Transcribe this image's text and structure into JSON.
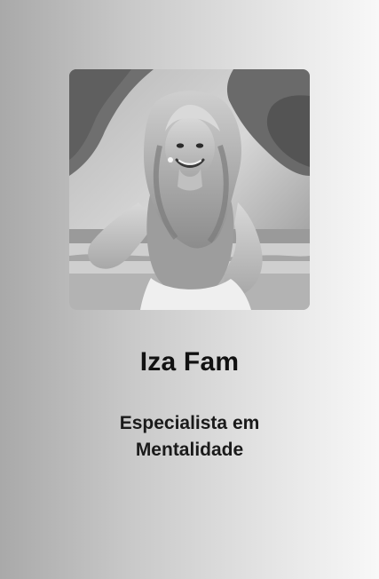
{
  "profile": {
    "name": "Iza Fam",
    "role_line_1": "Especialista em",
    "role_line_2": "Mentalidade",
    "photo": {
      "kind": "portrait-photo",
      "style": "black-and-white"
    }
  }
}
